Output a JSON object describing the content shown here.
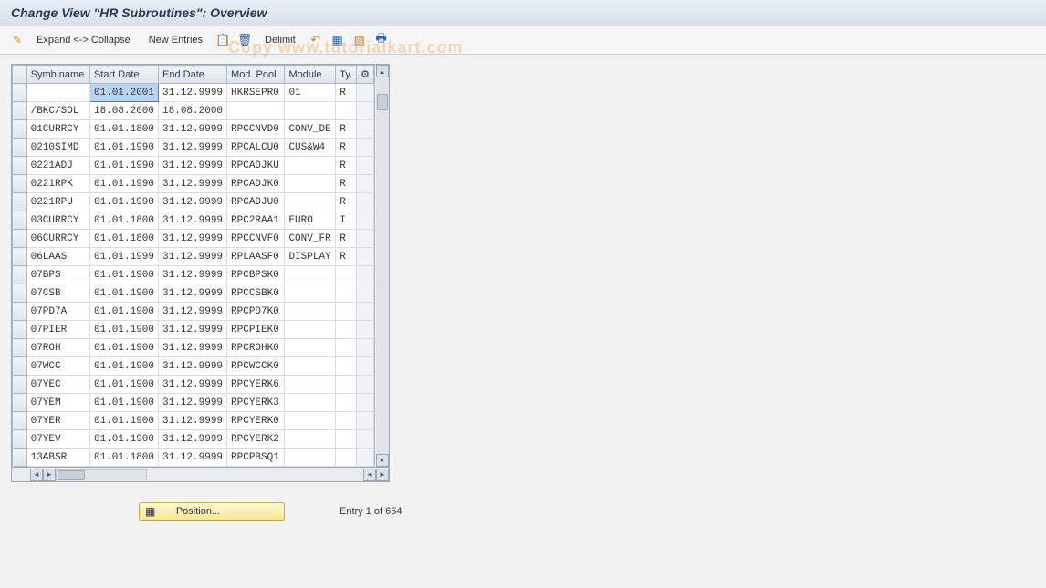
{
  "title": "Change View \"HR Subroutines\": Overview",
  "toolbar": {
    "expand_collapse": "Expand <-> Collapse",
    "new_entries": "New Entries",
    "delimit": "Delimit"
  },
  "table": {
    "headers": {
      "symb": "Symb.name",
      "start": "Start Date",
      "end": "End Date",
      "mod_pool": "Mod. Pool",
      "module": "Module",
      "ty": "Ty."
    },
    "rows": [
      {
        "symb": "",
        "start": "01.01.2001",
        "end": "31.12.9999",
        "mod": "HKRSEPR0",
        "module": "01",
        "ty": "R",
        "selected": true
      },
      {
        "symb": "/BKC/SOL",
        "start": "18.08.2000",
        "end": "18.08.2000",
        "mod": "",
        "module": "",
        "ty": ""
      },
      {
        "symb": "01CURRCY",
        "start": "01.01.1800",
        "end": "31.12.9999",
        "mod": "RPCCNVD0",
        "module": "CONV_DE",
        "ty": "R"
      },
      {
        "symb": "0210SIMD",
        "start": "01.01.1990",
        "end": "31.12.9999",
        "mod": "RPCALCU0",
        "module": "CUS&W4",
        "ty": "R"
      },
      {
        "symb": "0221ADJ",
        "start": "01.01.1990",
        "end": "31.12.9999",
        "mod": "RPCADJKU",
        "module": "",
        "ty": "R"
      },
      {
        "symb": "0221RPK",
        "start": "01.01.1990",
        "end": "31.12.9999",
        "mod": "RPCADJK0",
        "module": "",
        "ty": "R"
      },
      {
        "symb": "0221RPU",
        "start": "01.01.1990",
        "end": "31.12.9999",
        "mod": "RPCADJU0",
        "module": "",
        "ty": "R"
      },
      {
        "symb": "03CURRCY",
        "start": "01.01.1800",
        "end": "31.12.9999",
        "mod": "RPC2RAA1",
        "module": "EURO",
        "ty": "I"
      },
      {
        "symb": "06CURRCY",
        "start": "01.01.1800",
        "end": "31.12.9999",
        "mod": "RPCCNVF0",
        "module": "CONV_FR",
        "ty": "R"
      },
      {
        "symb": "06LAAS",
        "start": "01.01.1999",
        "end": "31.12.9999",
        "mod": "RPLAASF0",
        "module": "DISPLAY",
        "ty": "R"
      },
      {
        "symb": "07BPS",
        "start": "01.01.1900",
        "end": "31.12.9999",
        "mod": "RPCBPSK0",
        "module": "",
        "ty": ""
      },
      {
        "symb": "07CSB",
        "start": "01.01.1900",
        "end": "31.12.9999",
        "mod": "RPCCSBK0",
        "module": "",
        "ty": ""
      },
      {
        "symb": "07PD7A",
        "start": "01.01.1900",
        "end": "31.12.9999",
        "mod": "RPCPD7K0",
        "module": "",
        "ty": ""
      },
      {
        "symb": "07PIER",
        "start": "01.01.1900",
        "end": "31.12.9999",
        "mod": "RPCPIEK0",
        "module": "",
        "ty": ""
      },
      {
        "symb": "07ROH",
        "start": "01.01.1900",
        "end": "31.12.9999",
        "mod": "RPCROHK0",
        "module": "",
        "ty": ""
      },
      {
        "symb": "07WCC",
        "start": "01.01.1900",
        "end": "31.12.9999",
        "mod": "RPCWCCK0",
        "module": "",
        "ty": ""
      },
      {
        "symb": "07YEC",
        "start": "01.01.1900",
        "end": "31.12.9999",
        "mod": "RPCYERK6",
        "module": "",
        "ty": ""
      },
      {
        "symb": "07YEM",
        "start": "01.01.1900",
        "end": "31.12.9999",
        "mod": "RPCYERK3",
        "module": "",
        "ty": ""
      },
      {
        "symb": "07YER",
        "start": "01.01.1900",
        "end": "31.12.9999",
        "mod": "RPCYERK0",
        "module": "",
        "ty": ""
      },
      {
        "symb": "07YEV",
        "start": "01.01.1900",
        "end": "31.12.9999",
        "mod": "RPCYERK2",
        "module": "",
        "ty": ""
      },
      {
        "symb": "13ABSR",
        "start": "01.01.1800",
        "end": "31.12.9999",
        "mod": "RPCPBSQ1",
        "module": "",
        "ty": ""
      }
    ]
  },
  "footer": {
    "position_label": "Position...",
    "entry_text": "Entry 1 of 654"
  },
  "watermark": "Copy www.tutorialkart.com"
}
